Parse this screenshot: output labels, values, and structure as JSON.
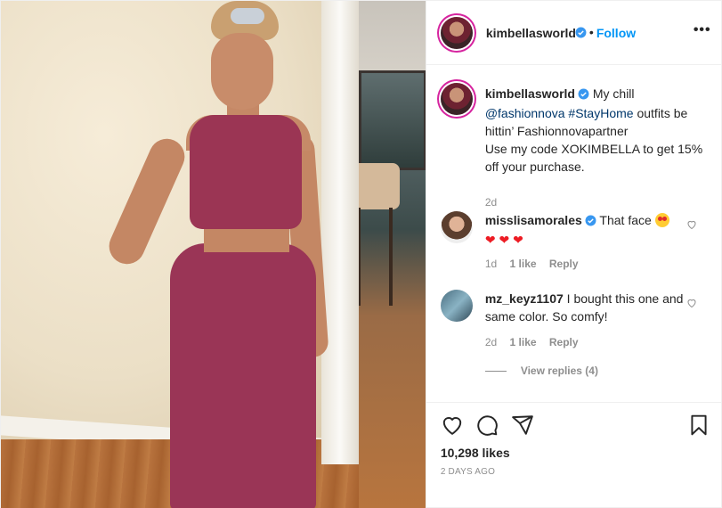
{
  "header": {
    "username": "kimbellasworld",
    "dot": "•",
    "follow_label": "Follow",
    "more_label": "•••"
  },
  "caption": {
    "username": "kimbellasworld",
    "text_before": "My chill",
    "mention": "@fashionnova",
    "hashtag": "#StayHome",
    "text_after": "outfits be hittin’ Fashionnovapartner",
    "line2": "Use my code XOKIMBELLA to get 15% off your purchase.",
    "time": "2d"
  },
  "comments": [
    {
      "username": "misslisamorales",
      "text": "That face",
      "time": "1d",
      "likes": "1 like",
      "reply_label": "Reply"
    },
    {
      "username": "mz_keyz1107",
      "text": "I bought this one and same color. So comfy!",
      "time": "2d",
      "likes": "1 like",
      "reply_label": "Reply"
    }
  ],
  "view_replies": "View replies (4)",
  "actions": {
    "likes": "10,298 likes",
    "date": "2 DAYS AGO"
  },
  "colors": {
    "accent_blue": "#0095f6",
    "link": "#00376b",
    "muted": "#8e8e8e"
  },
  "icons": [
    "verified-badge-icon",
    "more-icon",
    "heart-icon",
    "comment-icon",
    "share-icon",
    "bookmark-icon"
  ]
}
